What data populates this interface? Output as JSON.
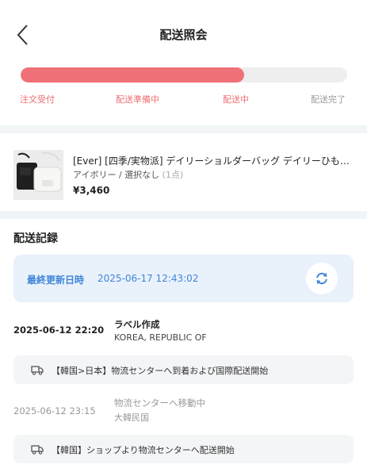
{
  "header": {
    "title": "配送照会",
    "back_icon": "chevron-left-icon"
  },
  "progress": {
    "value": 0.685,
    "fill_color": "#f07178",
    "steps": [
      {
        "label": "注文受付",
        "active": true
      },
      {
        "label": "配送準備中",
        "active": true
      },
      {
        "label": "配送中",
        "active": true
      },
      {
        "label": "配送完了",
        "active": false
      }
    ]
  },
  "product": {
    "name": "[Ever] [四季/実物派] デイリーショルダーバッグ デイリーひもバッグ",
    "option": "アイボリー / 選択なし",
    "quantity": "(1点)",
    "price": "¥3,460"
  },
  "records": {
    "section_title": "配送記録",
    "last_updated_label": "最終更新日時",
    "last_updated_value": "2025-06-17 12:43:02",
    "refresh_icon": "refresh-icon",
    "items": [
      {
        "time": "2025-06-12 22:20",
        "title": "ラベル作成",
        "location": "KOREA, REPUBLIC OF"
      },
      {
        "event": "【韓国>日本】物流センターへ到着および国際配送開始",
        "icon": "truck-icon"
      },
      {
        "time": "2025-06-12 23:15",
        "title": "物流センターへ移動中",
        "location": "大韓民国"
      },
      {
        "event": "【韓国】ショップより物流センターへ配送開始",
        "icon": "truck-icon"
      }
    ]
  },
  "colors": {
    "accent": "#f07178",
    "info_blue": "#3f86d9",
    "info_bg": "#e9f1fb"
  }
}
